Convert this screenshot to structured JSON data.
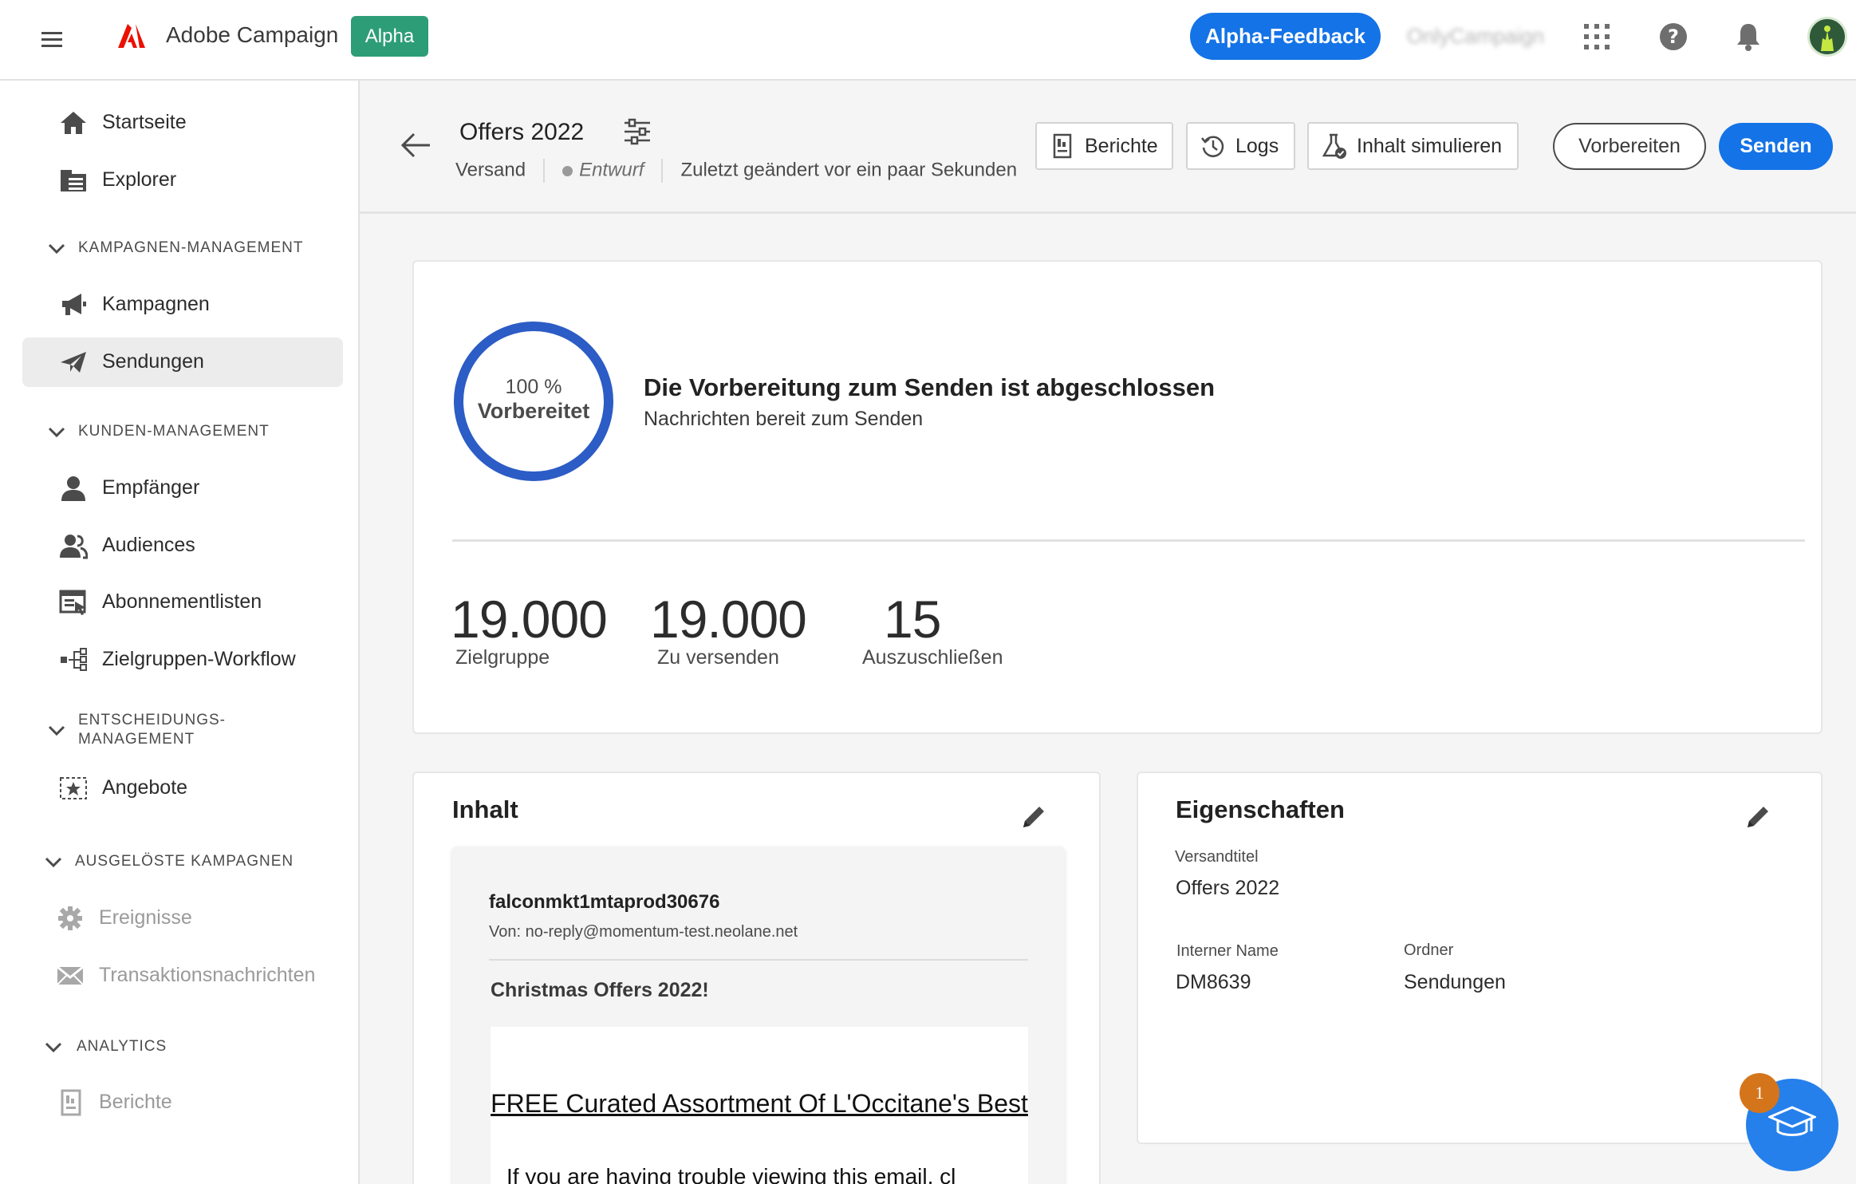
{
  "topbar": {
    "app_name": "Adobe Campaign",
    "alpha_badge": "Alpha",
    "feedback_label": "Alpha-Feedback",
    "org_name": "OnlyCampaign",
    "icons": [
      "menu-icon",
      "adobe-logo-icon",
      "apps-grid-icon",
      "help-icon",
      "bell-icon",
      "avatar"
    ]
  },
  "sidebar": {
    "items": [
      {
        "label": "Startseite",
        "icon": "home-icon"
      },
      {
        "label": "Explorer",
        "icon": "folder-icon"
      },
      {
        "label": "Kampagnen",
        "icon": "megaphone-icon"
      },
      {
        "label": "Sendungen",
        "icon": "send-icon",
        "active": true
      },
      {
        "label": "Empfänger",
        "icon": "user-icon"
      },
      {
        "label": "Audiences",
        "icon": "users-icon"
      },
      {
        "label": "Abonnementlisten",
        "icon": "subscription-list-icon"
      },
      {
        "label": "Zielgruppen-Workflow",
        "icon": "workflow-icon"
      },
      {
        "label": "Angebote",
        "icon": "offer-icon"
      },
      {
        "label": "Ereignisse",
        "icon": "gear-icon",
        "disabled": true
      },
      {
        "label": "Transaktionsnachrichten",
        "icon": "mail-icon",
        "disabled": true
      },
      {
        "label": "Berichte",
        "icon": "report-icon",
        "disabled": true
      }
    ],
    "sections": {
      "campaign_mgmt": "KAMPAGNEN-MANAGEMENT",
      "customer_mgmt": "KUNDEN-MANAGEMENT",
      "decision_mgmt_1": "ENTSCHEIDUNGS-",
      "decision_mgmt_2": "MANAGEMENT",
      "triggered": "AUSGELÖSTE KAMPAGNEN",
      "analytics": "ANALYTICS"
    }
  },
  "header": {
    "title": "Offers 2022",
    "type": "Versand",
    "status": "Entwurf",
    "modified": "Zuletzt geändert vor ein paar Sekunden",
    "reports_label": "Berichte",
    "logs_label": "Logs",
    "simulate_label": "Inhalt simulieren",
    "prepare_label": "Vorbereiten",
    "send_label": "Senden"
  },
  "status_card": {
    "progress_percent": 100,
    "progress_text": "100 %",
    "progress_label": "Vorbereitet",
    "title": "Die Vorbereitung zum Senden ist abgeschlossen",
    "subtitle": "Nachrichten bereit zum Senden",
    "metrics": [
      {
        "value": "19.000",
        "label": "Zielgruppe"
      },
      {
        "value": "19.000",
        "label": "Zu versenden"
      },
      {
        "value": "15",
        "label": "Auszuschließen"
      }
    ]
  },
  "content_card": {
    "title": "Inhalt",
    "sender_name": "falconmkt1mtaprod30676",
    "sender_address": "Von: no-reply@momentum-test.neolane.net",
    "subject": "Christmas Offers 2022!",
    "body_link": "FREE Curated Assortment Of L'Occitane's Best",
    "body_cut": "If you are having trouble viewing this email, cl"
  },
  "properties_card": {
    "title": "Eigenschaften",
    "delivery_title_label": "Versandtitel",
    "delivery_title_value": "Offers 2022",
    "internal_name_label": "Interner Name",
    "internal_name_value": "DM8639",
    "folder_label": "Ordner",
    "folder_value": "Sendungen"
  },
  "help_fab": {
    "badge": "1"
  },
  "colors": {
    "accent": "#1473e6",
    "alpha_badge": "#2d9d78",
    "ring": "#2c5cc5",
    "fab": "#2680eb",
    "badge": "#d4751c"
  }
}
